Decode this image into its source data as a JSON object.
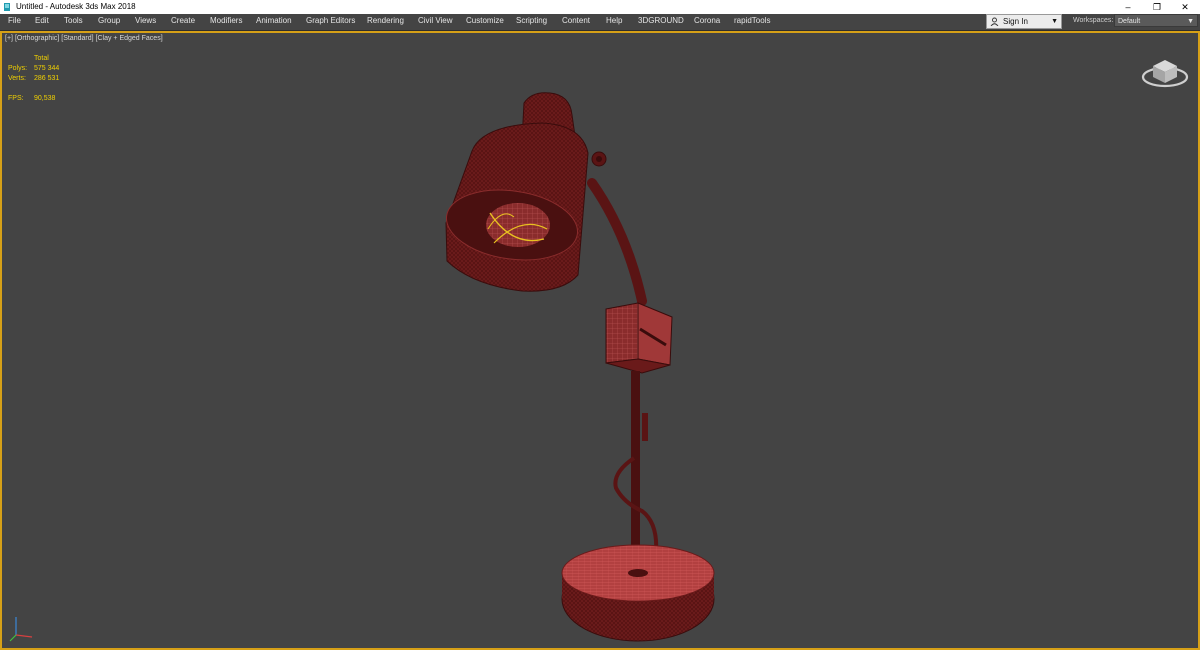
{
  "window": {
    "title": "Untitled - Autodesk 3ds Max 2018",
    "controls": {
      "minimize": "–",
      "restore": "❐",
      "close": "✕"
    }
  },
  "menu": [
    "File",
    "Edit",
    "Tools",
    "Group",
    "Views",
    "Create",
    "Modifiers",
    "Animation",
    "Graph Editors",
    "Rendering",
    "Civil View",
    "Customize",
    "Scripting",
    "Content",
    "Help",
    "3DGROUND",
    "Corona",
    "rapidTools"
  ],
  "account": {
    "sign_in": "Sign In"
  },
  "workspaces": {
    "label": "Workspaces:",
    "value": "Default"
  },
  "viewport": {
    "labels": [
      "[+]",
      "[Orthographic]",
      "[Standard]",
      "[Clay + Edged Faces]"
    ],
    "border_color": "#d6a017",
    "background": "#444444",
    "stats": {
      "header": "Total",
      "polys_label": "Polys:",
      "polys_value": "575 344",
      "verts_label": "Verts:",
      "verts_value": "286 531",
      "fps_label": "FPS:",
      "fps_value": "90,538",
      "color": "#f0d000"
    },
    "mesh_color": "#5a1414",
    "wire_color": "#c44a4a",
    "highlight_color": "#e8c020"
  },
  "icons": {
    "app": "3ds-max-icon",
    "user": "user-icon",
    "viewcube": "viewcube-icon",
    "axis": "axis-tripod-icon"
  }
}
